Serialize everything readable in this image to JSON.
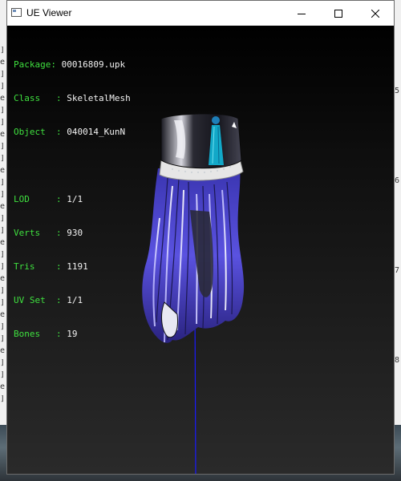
{
  "window": {
    "title": "UE Viewer"
  },
  "info": {
    "package_label": "Package: ",
    "package_value": "00016809.upk",
    "class_label": "Class   : ",
    "class_value": "SkeletalMesh",
    "object_label": "Object  : ",
    "object_value": "040014_KunN",
    "lod_label": "LOD     : ",
    "lod_value": "1/1",
    "verts_label": "Verts   : ",
    "verts_value": "930",
    "tris_label": "Tris    : ",
    "tris_value": "1191",
    "uvset_label": "UV Set  : ",
    "uvset_value": "1/1",
    "bones_label": "Bones   : ",
    "bones_value": "19"
  },
  "background": {
    "left_rows": [
      "]",
      "e",
      "]",
      "]",
      "e",
      "]",
      "]",
      "e",
      "]",
      "]",
      "e",
      "]",
      "]",
      "e",
      "]",
      "]",
      "e",
      "]",
      "]",
      "e",
      "]",
      "]",
      "e",
      "]",
      "]",
      "e",
      "]",
      "]",
      "e",
      "]"
    ],
    "right_digits": [
      "5",
      "6",
      "7",
      "8"
    ]
  },
  "colors": {
    "label": "#3fe03f",
    "value": "#f2f2f2",
    "bone_line": "#1a1aff"
  }
}
